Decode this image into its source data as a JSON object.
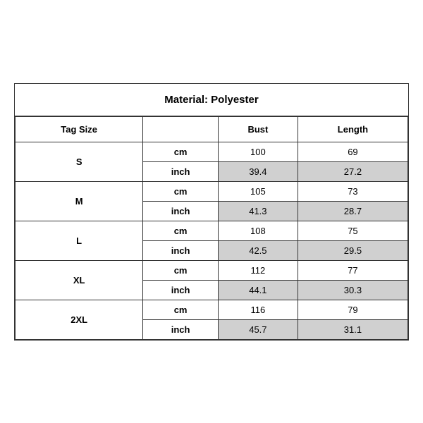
{
  "title": "Material: Polyester",
  "headers": {
    "tag_size": "Tag Size",
    "bust": "Bust",
    "length": "Length"
  },
  "sizes": [
    {
      "label": "S",
      "cm": {
        "bust": "100",
        "length": "69"
      },
      "inch": {
        "bust": "39.4",
        "length": "27.2"
      }
    },
    {
      "label": "M",
      "cm": {
        "bust": "105",
        "length": "73"
      },
      "inch": {
        "bust": "41.3",
        "length": "28.7"
      }
    },
    {
      "label": "L",
      "cm": {
        "bust": "108",
        "length": "75"
      },
      "inch": {
        "bust": "42.5",
        "length": "29.5"
      }
    },
    {
      "label": "XL",
      "cm": {
        "bust": "112",
        "length": "77"
      },
      "inch": {
        "bust": "44.1",
        "length": "30.3"
      }
    },
    {
      "label": "2XL",
      "cm": {
        "bust": "116",
        "length": "79"
      },
      "inch": {
        "bust": "45.7",
        "length": "31.1"
      }
    }
  ],
  "units": {
    "cm": "cm",
    "inch": "inch"
  }
}
